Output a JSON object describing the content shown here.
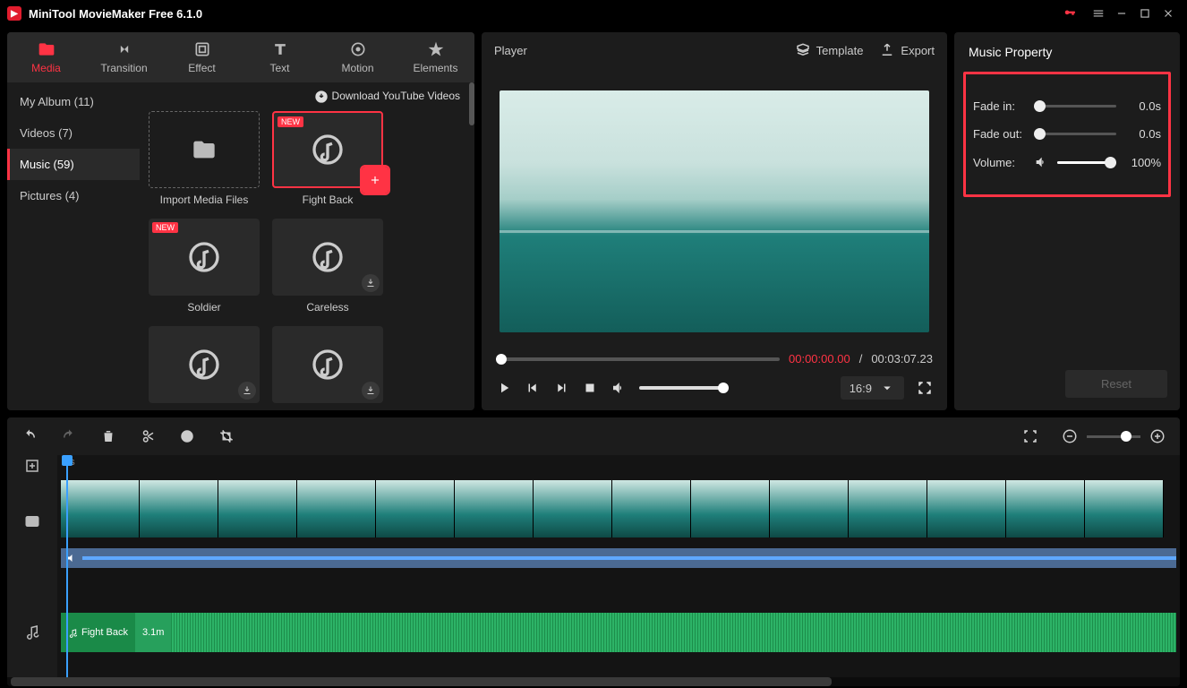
{
  "titlebar": {
    "title": "MiniTool MovieMaker Free 6.1.0"
  },
  "tabs": {
    "media": "Media",
    "transition": "Transition",
    "effect": "Effect",
    "text": "Text",
    "motion": "Motion",
    "elements": "Elements"
  },
  "sidebar": {
    "album": "My Album (11)",
    "videos": "Videos (7)",
    "music": "Music (59)",
    "pictures": "Pictures (4)"
  },
  "dlrow": "Download YouTube Videos",
  "thumbs": {
    "import": "Import Media Files",
    "fightback": "Fight Back",
    "soldier": "Soldier",
    "careless": "Careless",
    "new": "NEW"
  },
  "player": {
    "title": "Player",
    "template": "Template",
    "export": "Export",
    "current": "00:00:00.00",
    "sep": " / ",
    "duration": "00:03:07.23",
    "ratio": "16:9"
  },
  "prop": {
    "header": "Music Property",
    "fadein_lbl": "Fade in:",
    "fadein_val": "0.0s",
    "fadeout_lbl": "Fade out:",
    "fadeout_val": "0.0s",
    "volume_lbl": "Volume:",
    "volume_val": "100%",
    "reset": "Reset"
  },
  "timeline": {
    "zero": "0s",
    "clip_name": "Fight Back",
    "clip_len": "3.1m"
  }
}
